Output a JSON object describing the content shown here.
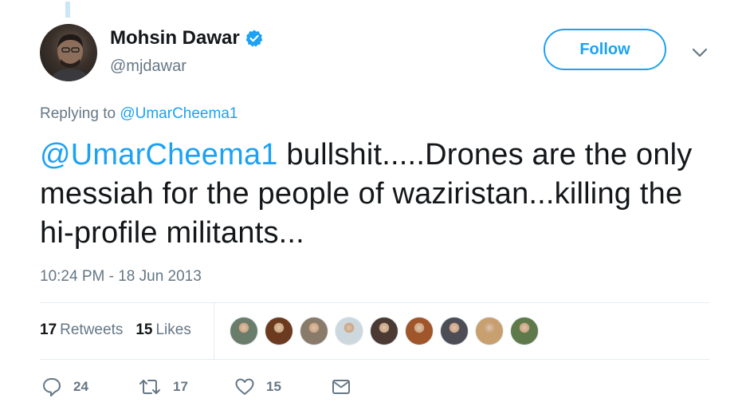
{
  "author": {
    "name": "Mohsin Dawar",
    "handle": "@mjdawar",
    "verified": true
  },
  "follow_button": {
    "label": "Follow",
    "color": "#1da1f2"
  },
  "reply": {
    "prefix": "Replying to",
    "to": "@UmarCheema1"
  },
  "tweet": {
    "mention": "@UmarCheema1",
    "text": " bullshit.....Drones are the only messiah for the people of waziristan...killing the hi-profile militants...",
    "timestamp": "10:24 PM - 18 Jun 2013"
  },
  "stats": {
    "retweets_count": "17",
    "retweets_label": "Retweets",
    "likes_count": "15",
    "likes_label": "Likes",
    "liker_avatar_colors": [
      "#6a7d6a",
      "#6b3a1f",
      "#8a7a6a",
      "#cdd8de",
      "#4a3a33",
      "#a0552a",
      "#4d4d55",
      "#c8a070",
      "#5f7a4a"
    ]
  },
  "actions": {
    "reply_icon": "speech-bubble-icon",
    "reply_count": "24",
    "retweet_icon": "retweet-arrows-icon",
    "retweet_count": "17",
    "like_icon": "heart-icon",
    "like_count": "15",
    "message_icon": "envelope-icon"
  },
  "colors": {
    "accent": "#1da1f2",
    "secondary_text": "#657786",
    "divider": "#e6ecf0"
  }
}
